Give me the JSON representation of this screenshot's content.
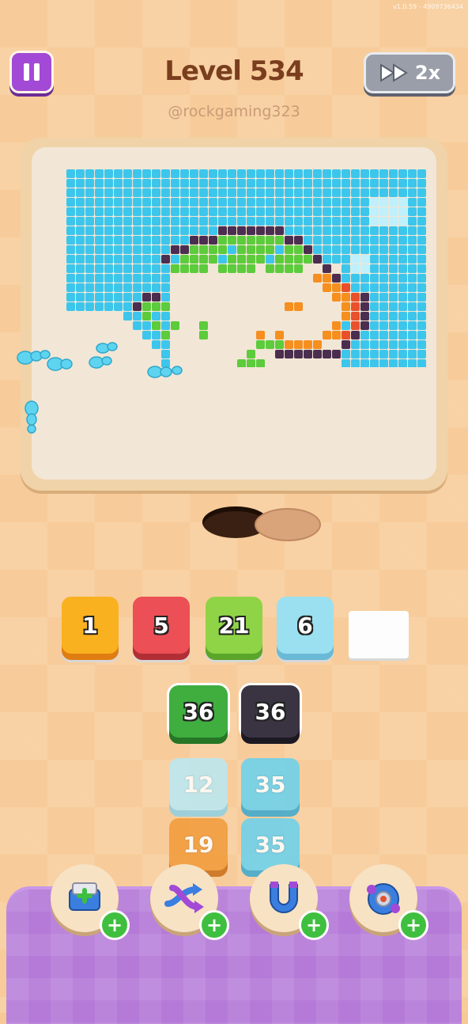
{
  "version": "v1.0.59 - 4909736434",
  "level": {
    "title": "Level 534"
  },
  "watermark": "@rockgaming323",
  "speed": {
    "label": "2x"
  },
  "colors": {
    "cyan": "#3cc6ec",
    "dark": "#4b2e4f",
    "green": "#5ccb3c",
    "orange": "#f58f1f",
    "red": "#e8512c",
    "cream": "#f2e6d6"
  },
  "color_slots": [
    {
      "value": "1",
      "color": "#f9b11f",
      "shade": "#e07d12"
    },
    {
      "value": "5",
      "color": "#ec4f55",
      "shade": "#b22e35"
    },
    {
      "value": "21",
      "color": "#8fd446",
      "shade": "#5aa52a"
    },
    {
      "value": "6",
      "color": "#9be0f0",
      "shade": "#6ab9d6"
    }
  ],
  "stacks": [
    {
      "value": "36",
      "color": "#3fae3f",
      "shade": "#267626"
    },
    {
      "value": "36",
      "color": "#3a3442",
      "shade": "#1d1922"
    },
    {
      "value": "12",
      "color": "#b8e9f5",
      "shade": "#8fd0e4"
    },
    {
      "value": "35",
      "color": "#67d1ef",
      "shade": "#3aa8cf"
    },
    {
      "value": "19",
      "color": "#f29a38",
      "shade": "#c96d18"
    },
    {
      "value": "35",
      "color": "#67d1ef",
      "shade": "#3aa8cf"
    }
  ],
  "boosters": [
    {
      "name": "add-slot",
      "icon": "add-tray-icon"
    },
    {
      "name": "shuffle",
      "icon": "shuffle-arrows-icon"
    },
    {
      "name": "magnet",
      "icon": "magnet-icon"
    },
    {
      "name": "blast",
      "icon": "bomb-icon"
    }
  ]
}
